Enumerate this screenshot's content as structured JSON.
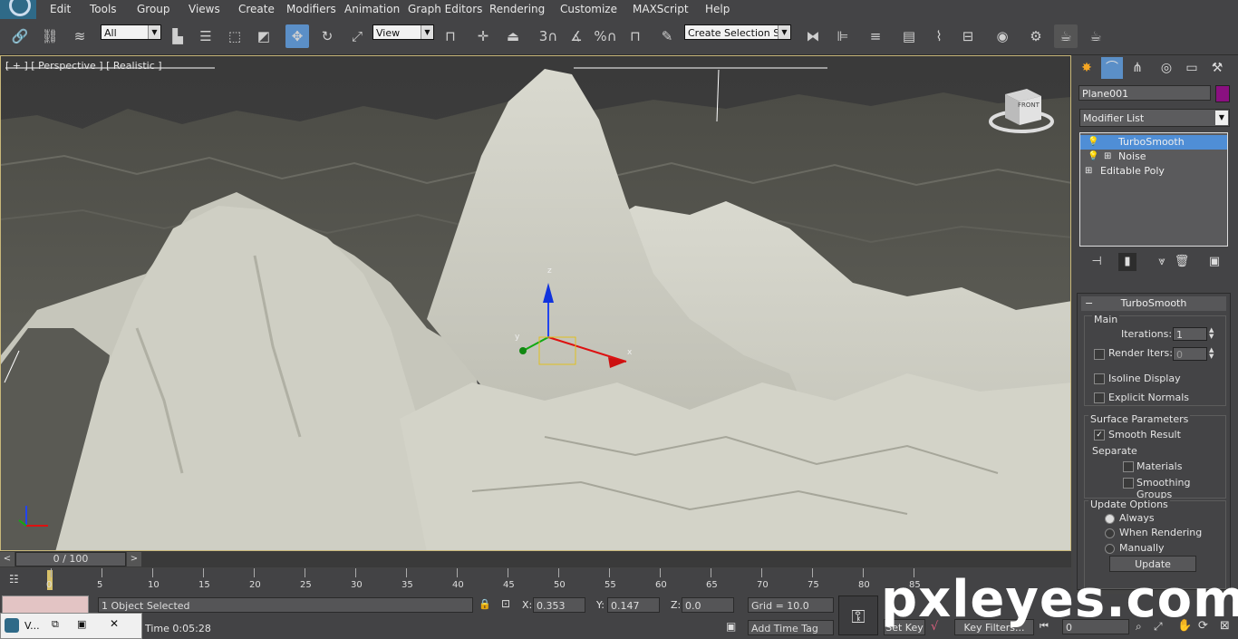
{
  "menu": [
    "Edit",
    "Tools",
    "Group",
    "Views",
    "Create",
    "Modifiers",
    "Animation",
    "Graph Editors",
    "Rendering",
    "Customize",
    "MAXScript",
    "Help"
  ],
  "toolbar": {
    "filter_select": "All",
    "ref_coord_select": "View",
    "named_selection": "Create Selection Se",
    "snaps": {
      "angle": "3",
      "percent": "%"
    }
  },
  "viewport": {
    "label": "[ + ] [ Perspective ] [ Realistic ]",
    "viewcube_face": "FRONT",
    "gizmo_axes": [
      "x",
      "y",
      "z"
    ]
  },
  "panel": {
    "object_name": "Plane001",
    "object_color": "#8a1080",
    "modifier_list": "Modifier List",
    "stack": [
      {
        "label": "TurboSmooth",
        "selected": true
      },
      {
        "label": "Noise",
        "selected": false
      },
      {
        "label": "Editable Poly",
        "selected": false
      }
    ],
    "rollout": {
      "title": "TurboSmooth",
      "main": {
        "title": "Main",
        "iterations_label": "Iterations:",
        "iterations": "1",
        "render_iters_label": "Render Iters:",
        "render_iters": "0",
        "render_iters_checked": false,
        "isoline_display": "Isoline Display",
        "explicit_normals": "Explicit Normals"
      },
      "surface": {
        "title": "Surface Parameters",
        "smooth_result": "Smooth Result",
        "smooth_result_checked": true,
        "separate": "Separate",
        "materials": "Materials",
        "smoothing_groups": "Smoothing Groups"
      },
      "update": {
        "title": "Update Options",
        "always": "Always",
        "when_rendering": "When Rendering",
        "manually": "Manually",
        "selected": "Always",
        "button": "Update"
      }
    }
  },
  "timeline": {
    "frame_display": "0 / 100",
    "ticks": [
      0,
      5,
      10,
      15,
      20,
      25,
      30,
      35,
      40,
      45,
      50,
      55,
      60,
      65,
      70,
      75,
      80,
      85
    ]
  },
  "status": {
    "selection": "1 Object Selected",
    "x": "0.353",
    "y": "0.147",
    "z": "0.0",
    "grid": "Grid = 10.0",
    "time": "Time  0:05:28",
    "add_time_tag": "Add Time Tag",
    "set_key": "Set Key",
    "key_filters": "Key Filters...",
    "current_frame": "0",
    "x_label": "X:",
    "y_label": "Y:",
    "z_label": "Z:"
  },
  "watermark": "pxleyes.com",
  "taskbar_window": "V..."
}
